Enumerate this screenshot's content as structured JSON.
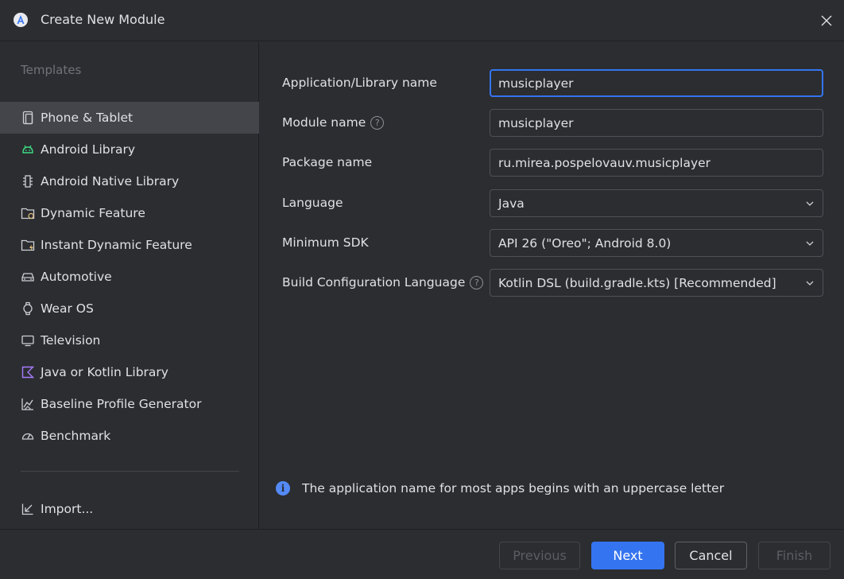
{
  "window": {
    "title": "Create New Module"
  },
  "sidebar": {
    "heading": "Templates",
    "items": [
      {
        "label": "Phone & Tablet",
        "icon": "phone-tablet-icon",
        "selected": true
      },
      {
        "label": "Android Library",
        "icon": "android-icon"
      },
      {
        "label": "Android Native Library",
        "icon": "native-chip-icon"
      },
      {
        "label": "Dynamic Feature",
        "icon": "dynamic-folder-icon"
      },
      {
        "label": "Instant Dynamic Feature",
        "icon": "instant-folder-icon"
      },
      {
        "label": "Automotive",
        "icon": "car-icon"
      },
      {
        "label": "Wear OS",
        "icon": "watch-icon"
      },
      {
        "label": "Television",
        "icon": "tv-icon"
      },
      {
        "label": "Java or Kotlin Library",
        "icon": "kotlin-icon"
      },
      {
        "label": "Baseline Profile Generator",
        "icon": "profile-chart-icon"
      },
      {
        "label": "Benchmark",
        "icon": "gauge-icon"
      }
    ],
    "import_label": "Import..."
  },
  "form": {
    "app_name_label": "Application/Library name",
    "app_name_value": "musicplayer",
    "module_name_label": "Module name",
    "module_name_value": "musicplayer",
    "package_name_label": "Package name",
    "package_name_value": "ru.mirea.pospelovauv.musicplayer",
    "language_label": "Language",
    "language_value": "Java",
    "min_sdk_label": "Minimum SDK",
    "min_sdk_value": "API 26 (\"Oreo\"; Android 8.0)",
    "build_config_label": "Build Configuration Language",
    "build_config_value": "Kotlin DSL (build.gradle.kts) [Recommended]",
    "help_glyph": "?"
  },
  "info": {
    "glyph": "i",
    "message": "The application name for most apps begins with an uppercase letter"
  },
  "footer": {
    "previous": "Previous",
    "next": "Next",
    "cancel": "Cancel",
    "finish": "Finish"
  },
  "colors": {
    "accent": "#3574f0",
    "background": "#2b2d30",
    "selected": "#43454a",
    "android_green": "#3ddc84",
    "kotlin_purple": "#a97bff"
  }
}
